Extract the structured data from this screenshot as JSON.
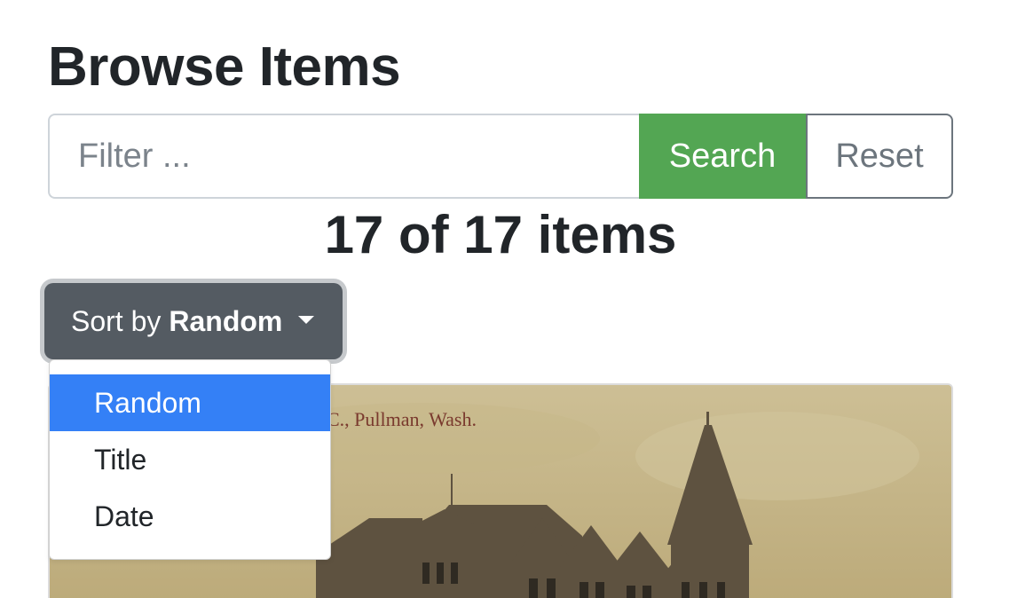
{
  "header": {
    "title": "Browse Items"
  },
  "search": {
    "placeholder": "Filter ...",
    "value": "",
    "search_label": "Search",
    "reset_label": "Reset"
  },
  "results": {
    "count_text": "17 of 17 items"
  },
  "sort": {
    "prefix": "Sort by",
    "selected": "Random",
    "options": [
      {
        "label": "Random",
        "active": true
      },
      {
        "label": "Title",
        "active": false
      },
      {
        "label": "Date",
        "active": false
      }
    ]
  },
  "item": {
    "caption": "C., Pullman, Wash."
  },
  "colors": {
    "search_button": "#53a653",
    "sort_button": "#545b62",
    "active_option": "#3480f6"
  }
}
